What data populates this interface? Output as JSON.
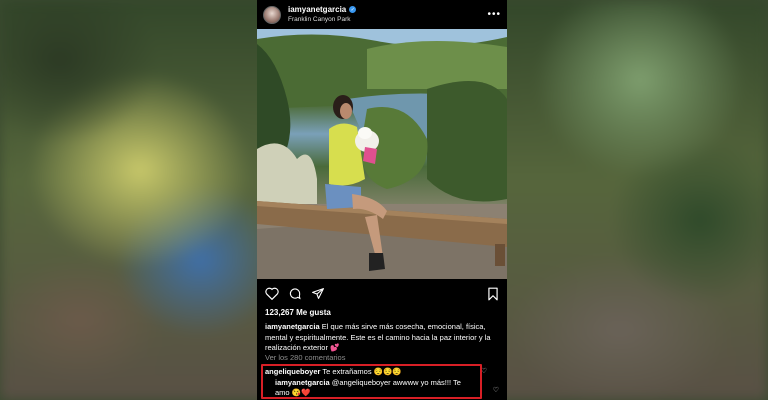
{
  "post": {
    "username": "iamyanetgarcia",
    "location": "Franklin Canyon Park",
    "more_label": "•••",
    "likes": "123,267 Me gusta",
    "caption_user": "iamyanetgarcia",
    "caption_text": "El que más sirve más cosecha, emocional, física, mental y espiritualmente. Este es el camino hacia la paz interior y la realización exterior 💕",
    "view_comments": "Ver los 280 comentarios",
    "comments": [
      {
        "user": "angeliqueboyer",
        "text": "Te extrañamos 😌😌😌"
      }
    ],
    "reply": {
      "user": "iamyanetgarcia",
      "text": "@angeliqueboyer awwww yo más!!! Te amo 😘❤️"
    }
  },
  "colors": {
    "verified": "#3897f0",
    "highlight_border": "#d81f26",
    "muted_text": "#8e8e8e"
  },
  "icons": [
    "heart-icon",
    "comment-icon",
    "share-icon",
    "bookmark-icon",
    "verified-icon",
    "more-icon"
  ]
}
